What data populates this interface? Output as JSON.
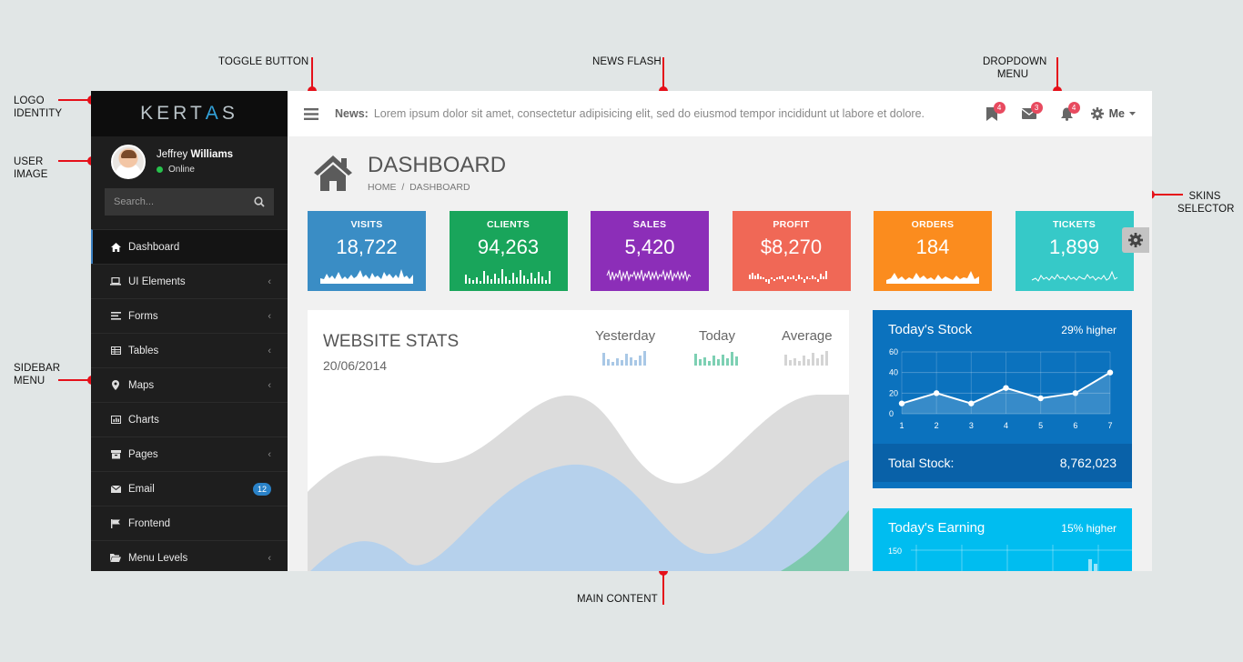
{
  "annotations": {
    "toggle": "TOGGLE BUTTON",
    "news": "NEWS FLASH",
    "dropdown_1": "DROPDOWN",
    "dropdown_2": "MENU",
    "logo_1": "LOGO",
    "logo_2": "IDENTITY",
    "user_1": "USER",
    "user_2": "IMAGE",
    "sidebar_1": "SIDEBAR",
    "sidebar_2": "MENU",
    "skins_1": "SKINS",
    "skins_2": "SELECTOR",
    "main": "MAIN CONTENT"
  },
  "logo": {
    "part1": "KERT",
    "part2": "A",
    "part3": "S"
  },
  "user": {
    "first": "Jeffrey",
    "last": "Williams",
    "status": "Online"
  },
  "search": {
    "placeholder": "Search..."
  },
  "sidebar": {
    "items": [
      {
        "label": "Dashboard"
      },
      {
        "label": "UI Elements"
      },
      {
        "label": "Forms"
      },
      {
        "label": "Tables"
      },
      {
        "label": "Maps"
      },
      {
        "label": "Charts"
      },
      {
        "label": "Pages"
      },
      {
        "label": "Email",
        "badge": "12"
      },
      {
        "label": "Frontend"
      },
      {
        "label": "Menu Levels"
      }
    ]
  },
  "topbar": {
    "news_label": "News:",
    "news_text": "Lorem ipsum dolor sit amet, consectetur adipisicing elit, sed do eiusmod tempor incididunt ut labore et dolore.",
    "bookmark_count": "4",
    "mail_count": "3",
    "bell_count": "4",
    "me_label": "Me"
  },
  "page": {
    "title": "DASHBOARD",
    "breadcrumb": "HOME  /  DASHBOARD"
  },
  "tiles": [
    {
      "label": "VISITS",
      "value": "18,722",
      "color": "#3a8dc5"
    },
    {
      "label": "CLIENTS",
      "value": "94,263",
      "color": "#19a55b"
    },
    {
      "label": "SALES",
      "value": "5,420",
      "color": "#8c2eb8"
    },
    {
      "label": "PROFIT",
      "value": "$8,270",
      "color": "#f06856"
    },
    {
      "label": "ORDERS",
      "value": "184",
      "color": "#fb8c1e"
    },
    {
      "label": "TICKETS",
      "value": "1,899",
      "color": "#36c9c8"
    }
  ],
  "website_stats": {
    "title": "WEBSITE STATS",
    "date": "20/06/2014",
    "yesterday": "Yesterday",
    "today": "Today",
    "average": "Average"
  },
  "stock": {
    "title": "Today's Stock",
    "sub": "29% higher",
    "total_label": "Total Stock:",
    "total_value": "8,762,023",
    "color": "#0b72be"
  },
  "earning": {
    "title": "Today's Earning",
    "sub": "15% higher",
    "color": "#00bdf0"
  },
  "chart_data": [
    {
      "type": "line",
      "title": "Today's Stock",
      "x": [
        1,
        2,
        3,
        4,
        5,
        6,
        7
      ],
      "series": [
        {
          "values": [
            10,
            20,
            10,
            25,
            15,
            20,
            40
          ]
        }
      ],
      "ylim": [
        0,
        60
      ],
      "yticks": [
        0,
        20,
        40,
        60
      ],
      "grid": true
    }
  ]
}
